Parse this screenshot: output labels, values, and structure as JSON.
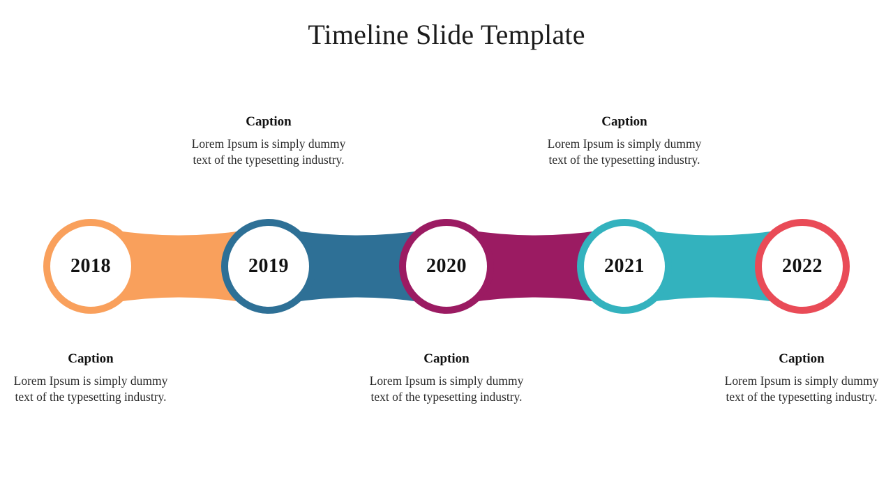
{
  "slide": {
    "title": "Timeline Slide Template",
    "background_color": "#ffffff"
  },
  "palette": {
    "orange": "#F9A05C",
    "blue": "#2E7096",
    "magenta": "#9B1B62",
    "teal": "#33B2BE",
    "red": "#E94B57",
    "text": "#111111"
  },
  "timeline": {
    "nodes": [
      {
        "year": "2018",
        "color": "#F9A05C",
        "caption_position": "bottom"
      },
      {
        "year": "2019",
        "color": "#2E7096",
        "caption_position": "top"
      },
      {
        "year": "2020",
        "color": "#9B1B62",
        "caption_position": "bottom"
      },
      {
        "year": "2021",
        "color": "#33B2BE",
        "caption_position": "top"
      },
      {
        "year": "2022",
        "color": "#E94B57",
        "caption_position": "bottom"
      }
    ],
    "connectors": [
      {
        "from": "2018",
        "to": "2019",
        "color": "#F9A05C"
      },
      {
        "from": "2019",
        "to": "2020",
        "color": "#2E7096"
      },
      {
        "from": "2020",
        "to": "2021",
        "color": "#9B1B62"
      },
      {
        "from": "2021",
        "to": "2022",
        "color": "#33B2BE"
      }
    ]
  },
  "captions": [
    {
      "id": "caption-2018",
      "title": "Caption",
      "body": "Lorem Ipsum is simply dummy text of the typesetting industry."
    },
    {
      "id": "caption-2019",
      "title": "Caption",
      "body": "Lorem Ipsum is simply dummy text of the typesetting industry."
    },
    {
      "id": "caption-2020",
      "title": "Caption",
      "body": "Lorem Ipsum is simply dummy text of the typesetting industry."
    },
    {
      "id": "caption-2021",
      "title": "Caption",
      "body": "Lorem Ipsum is simply dummy text of the typesetting industry."
    },
    {
      "id": "caption-2022",
      "title": "Caption",
      "body": "Lorem Ipsum is simply dummy text of the typesetting industry."
    }
  ]
}
